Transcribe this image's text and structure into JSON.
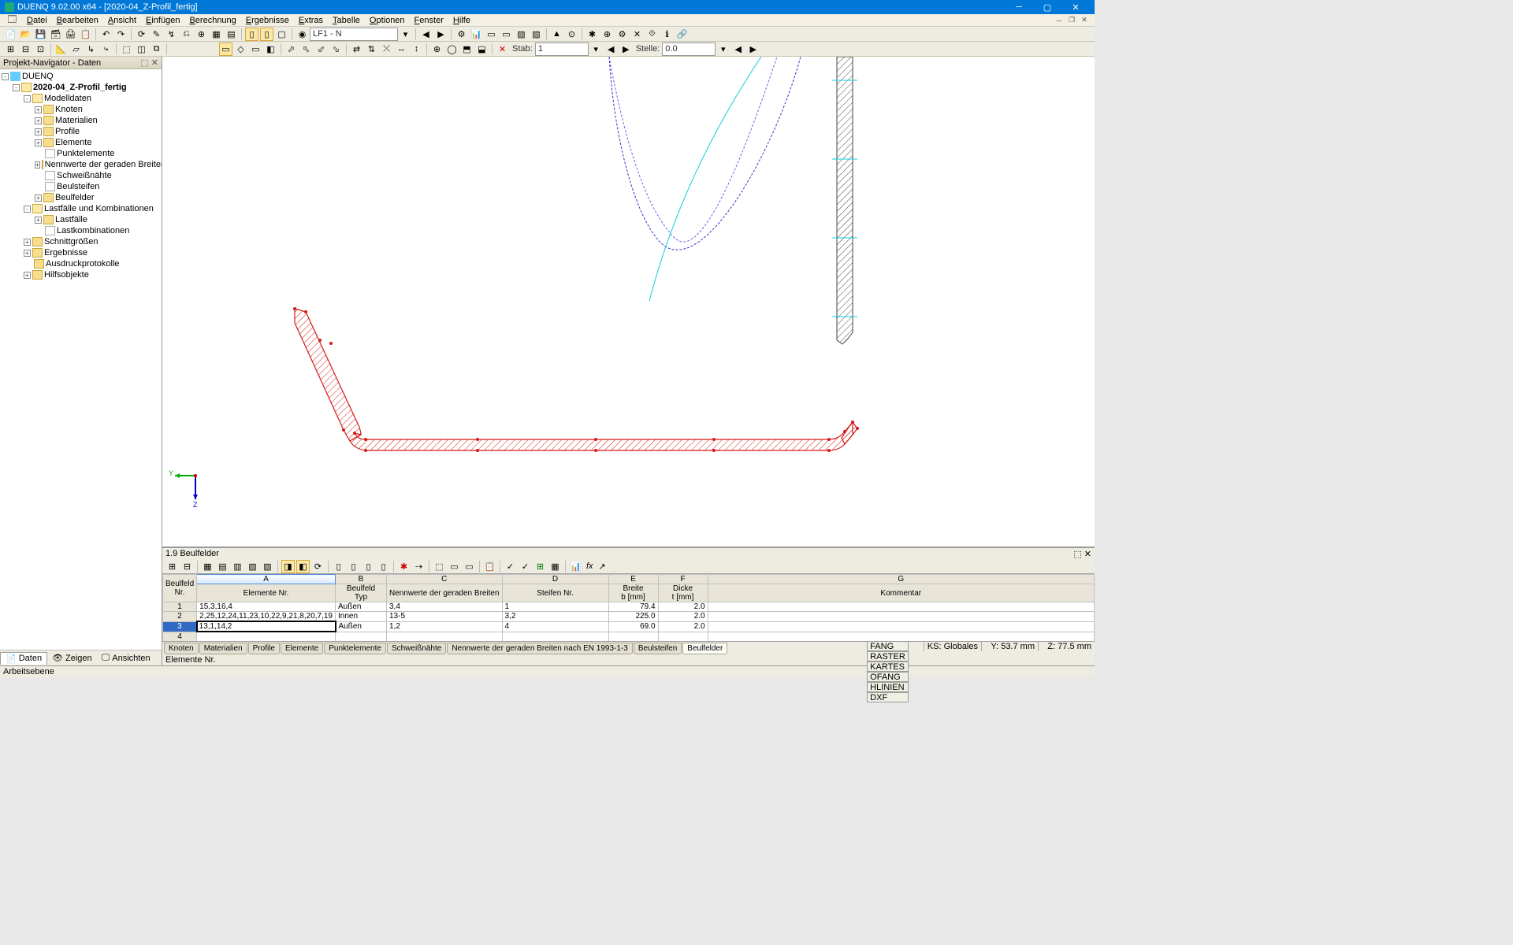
{
  "title": "DUENQ 9.02.00 x64 - [2020-04_Z-Profil_fertig]",
  "menu": [
    "Datei",
    "Bearbeiten",
    "Ansicht",
    "Einfügen",
    "Berechnung",
    "Ergebnisse",
    "Extras",
    "Tabelle",
    "Optionen",
    "Fenster",
    "Hilfe"
  ],
  "loadcase": "LF1 - N",
  "stab_label": "Stab:",
  "stab_value": "1",
  "stelle_label": "Stelle:",
  "stelle_value": "0.0",
  "nav": {
    "title": "Projekt-Navigator - Daten",
    "root": "DUENQ",
    "model": "2020-04_Z-Profil_fertig",
    "tree": [
      {
        "label": "Modelldaten",
        "icon": "folder",
        "exp": "-",
        "children": [
          {
            "label": "Knoten",
            "icon": "folder",
            "exp": "+"
          },
          {
            "label": "Materialien",
            "icon": "folder",
            "exp": "+"
          },
          {
            "label": "Profile",
            "icon": "folder",
            "exp": "+"
          },
          {
            "label": "Elemente",
            "icon": "folder",
            "exp": "+"
          },
          {
            "label": "Punktelemente",
            "icon": "leaf"
          },
          {
            "label": "Nennwerte der geraden Breiten",
            "icon": "folder",
            "exp": "+"
          },
          {
            "label": "Schweißnähte",
            "icon": "leaf"
          },
          {
            "label": "Beulsteifen",
            "icon": "leaf"
          },
          {
            "label": "Beulfelder",
            "icon": "folder",
            "exp": "+"
          }
        ]
      },
      {
        "label": "Lastfälle und Kombinationen",
        "icon": "folder",
        "exp": "-",
        "children": [
          {
            "label": "Lastfälle",
            "icon": "folder",
            "exp": "+"
          },
          {
            "label": "Lastkombinationen",
            "icon": "leaf"
          }
        ]
      },
      {
        "label": "Schnittgrößen",
        "icon": "folder",
        "exp": "+"
      },
      {
        "label": "Ergebnisse",
        "icon": "folder",
        "exp": "+"
      },
      {
        "label": "Ausdruckprotokolle",
        "icon": "folder"
      },
      {
        "label": "Hilfsobjekte",
        "icon": "folder",
        "exp": "+"
      }
    ],
    "tabs": [
      "Daten",
      "Zeigen",
      "Ansichten"
    ]
  },
  "bottom": {
    "title": "1.9 Beulfelder",
    "status": "Elemente Nr.",
    "col_letters": [
      "A",
      "B",
      "C",
      "D",
      "E",
      "F",
      "G"
    ],
    "headers_row1": [
      "Beulfeld",
      "",
      "Beulfeld",
      "",
      "",
      "Breite",
      "Dicke",
      ""
    ],
    "headers_row2": [
      "Nr.",
      "Elemente Nr.",
      "Typ",
      "Nennwerte der geraden Breiten",
      "Steifen Nr.",
      "b [mm]",
      "t [mm]",
      "Kommentar"
    ],
    "rows": [
      {
        "n": "1",
        "cells": [
          "15,3,16,4",
          "Außen",
          "3,4",
          "1",
          "79.4",
          "2.0",
          ""
        ]
      },
      {
        "n": "2",
        "cells": [
          "2,25,12,24,11,23,10,22,9,21,8,20,7,19",
          "Innen",
          "13-5",
          "3,2",
          "225.0",
          "2.0",
          ""
        ]
      },
      {
        "n": "3",
        "cells": [
          "13,1,14,2",
          "Außen",
          "1,2",
          "4",
          "69.0",
          "2.0",
          ""
        ],
        "selected": true
      },
      {
        "n": "4",
        "cells": [
          "",
          "",
          "",
          "",
          "",
          "",
          ""
        ]
      }
    ],
    "tabs": [
      "Knoten",
      "Materialien",
      "Profile",
      "Elemente",
      "Punktelemente",
      "Schweißnähte",
      "Nennwerte der geraden Breiten nach EN 1993-1-3",
      "Beulsteifen",
      "Beulfelder"
    ]
  },
  "status": {
    "left": "Arbeitsebene",
    "btns": [
      "FANG",
      "RASTER",
      "KARTES",
      "OFANG",
      "HLINIEN",
      "DXF"
    ],
    "ks": "KS: Globales",
    "y": "Y:   53.7 mm",
    "z": "Z:   77.5 mm"
  }
}
